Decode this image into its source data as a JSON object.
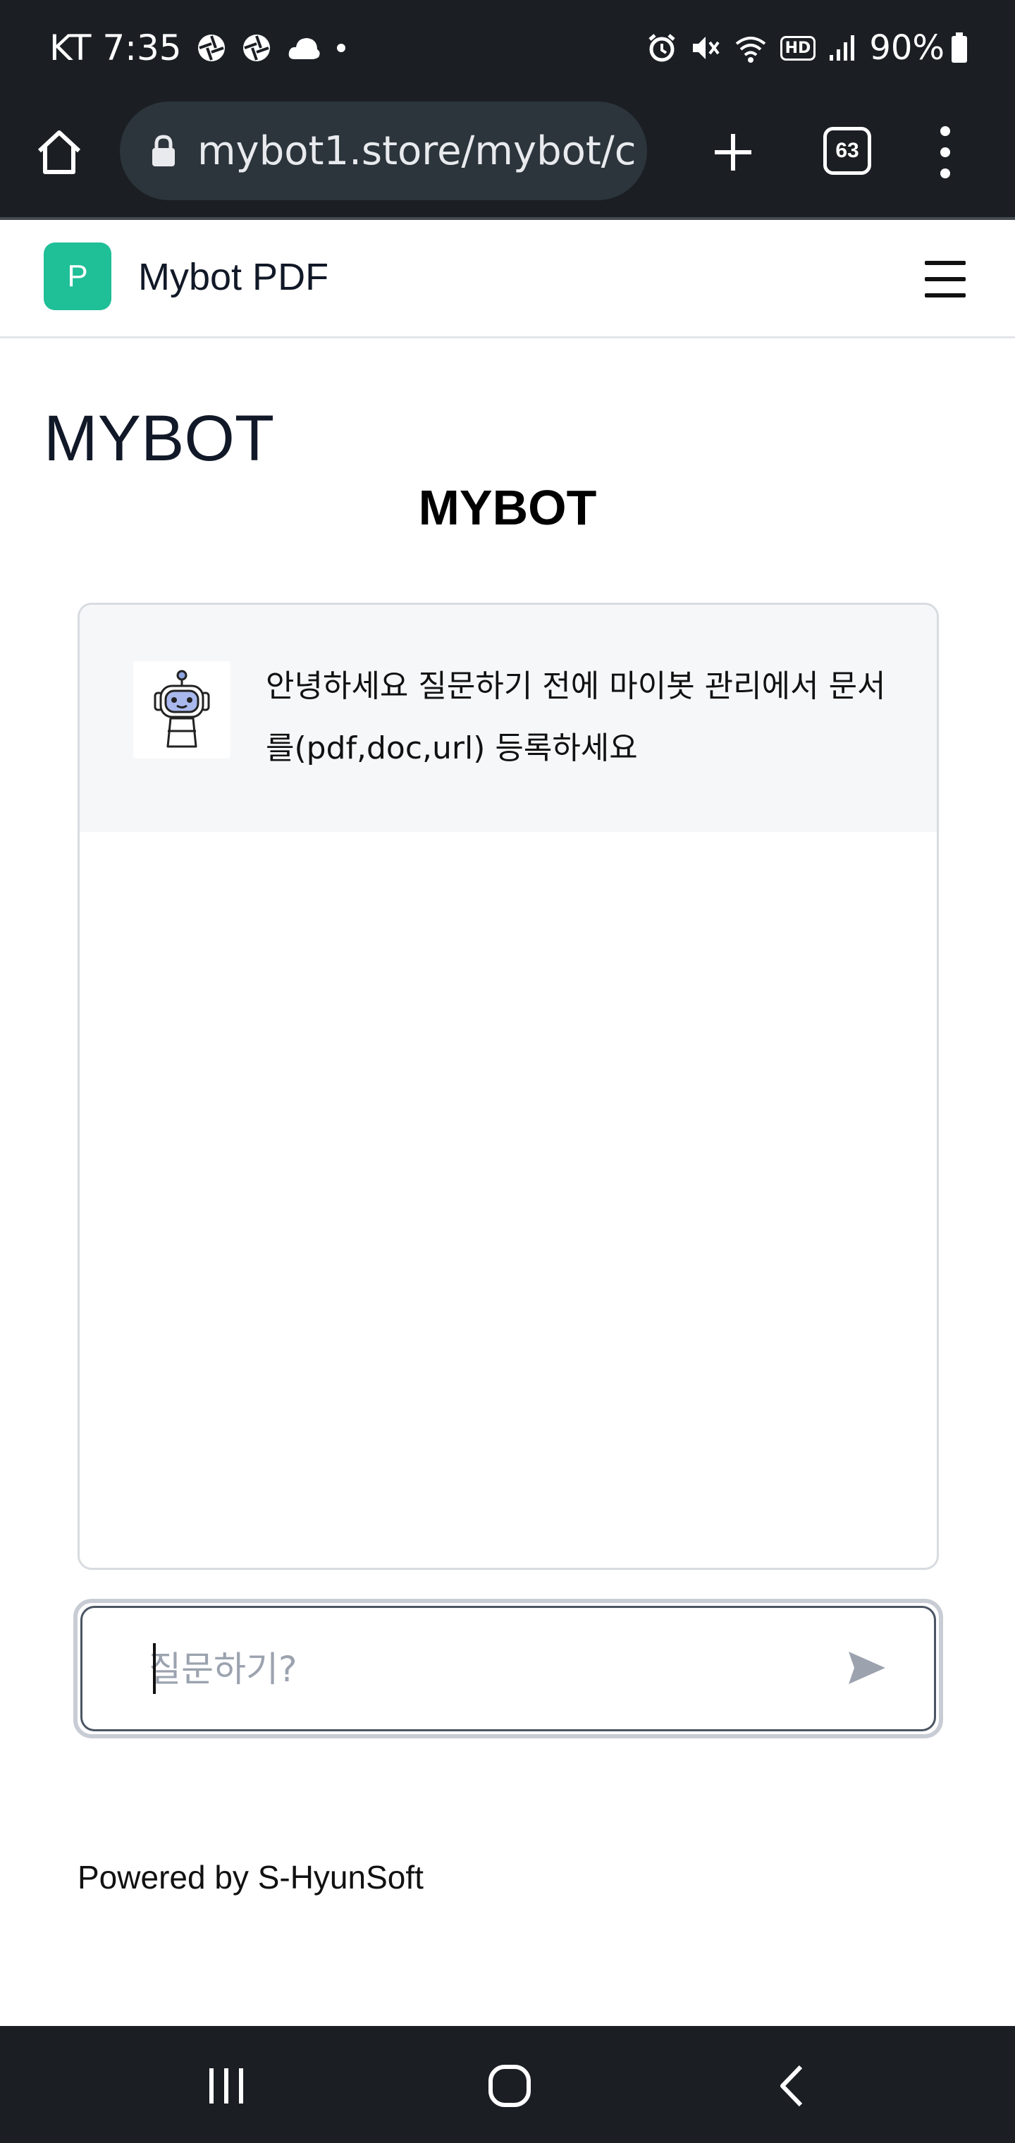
{
  "status_bar": {
    "carrier_time": "KT 7:35",
    "battery": "90%",
    "hd_label": "HD",
    "icons_left": [
      "aperture-icon",
      "aperture-icon",
      "cloud-icon",
      "dot-icon"
    ],
    "icons_right": [
      "alarm-icon",
      "mute-icon",
      "wifi-icon",
      "hd-icon",
      "signal-icon",
      "battery-icon"
    ]
  },
  "browser": {
    "url": "mybot1.store/mybot/c",
    "tab_count": "63"
  },
  "header": {
    "logo_letter": "P",
    "title": "Mybot PDF"
  },
  "main": {
    "heading": "MYBOT",
    "bot_title": "MYBOT",
    "messages": [
      {
        "sender": "bot",
        "text": "안녕하세요 질문하기 전에 마이봇 관리에서 문서를(pdf,doc,url) 등록하세요"
      }
    ],
    "input_placeholder": "질문하기?"
  },
  "footer": {
    "text": "Powered by S-HyunSoft"
  },
  "colors": {
    "accent": "#1fbf98",
    "system_bar": "#1b1f24",
    "message_bg": "#f6f7f9"
  }
}
